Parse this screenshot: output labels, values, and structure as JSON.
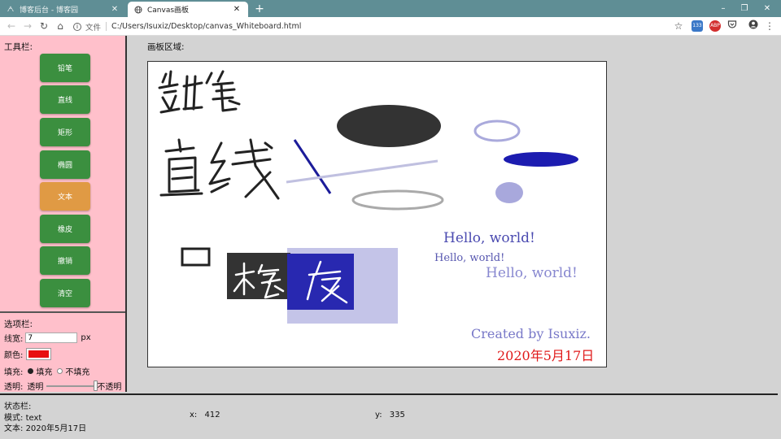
{
  "browser": {
    "tabs": [
      {
        "title": "博客后台 - 博客园",
        "active": false
      },
      {
        "title": "Canvas画板",
        "active": true
      }
    ],
    "new_tab": "+",
    "window_controls": {
      "minimize": "–",
      "restore": "❐",
      "close": "✕"
    },
    "nav": {
      "back": "←",
      "forward": "→",
      "reload": "↻",
      "home": "⌂"
    },
    "address": {
      "info": "i",
      "scheme": "文件",
      "url": "C:/Users/Isuxiz/Desktop/canvas_Whiteboard.html"
    },
    "extensions": {
      "star": "☆",
      "badge_count": "133",
      "abp": "ABP",
      "menu": "⋮"
    }
  },
  "toolbar": {
    "title": "工具栏:",
    "buttons": [
      {
        "label": "铅笔",
        "active": false
      },
      {
        "label": "直线",
        "active": false
      },
      {
        "label": "矩形",
        "active": false
      },
      {
        "label": "椭圆",
        "active": false
      },
      {
        "label": "文本",
        "active": true
      },
      {
        "label": "橡皮",
        "active": false
      },
      {
        "label": "撤销",
        "active": false
      },
      {
        "label": "清空",
        "active": false
      }
    ]
  },
  "options": {
    "title": "选项栏:",
    "line_width_label": "线宽:",
    "line_width_value": "7",
    "line_width_unit": "px",
    "color_label": "颜色:",
    "color_value": "#e81010",
    "fill_label": "填充:",
    "fill_on": "填充",
    "fill_off": "不填充",
    "fill_selected": "填充",
    "opacity_label": "透明:",
    "opacity_min": "透明",
    "opacity_max": "不透明",
    "opacity_level": 1.0
  },
  "canvas": {
    "title": "画板区域:",
    "handwriting": {
      "pencil": "铅笔",
      "line": "直线",
      "eraser": "橡皮"
    },
    "texts": [
      {
        "text": "Hello, world!",
        "color": "#4a4ab0"
      },
      {
        "text": "Hello, world!",
        "color": "#5858b0"
      },
      {
        "text": "Hello, world!",
        "color": "#8888d0"
      },
      {
        "text": "Created by Isuxiz.",
        "color": "#7878c8"
      },
      {
        "text": "2020年5月17日",
        "color": "#e01818"
      }
    ]
  },
  "status": {
    "title": "状态栏:",
    "mode_label": "模式:",
    "mode_value": "text",
    "x_label": "x:",
    "x_value": "412",
    "y_label": "y:",
    "y_value": "335",
    "text_label": "文本:",
    "text_value": "2020年5月17日"
  }
}
